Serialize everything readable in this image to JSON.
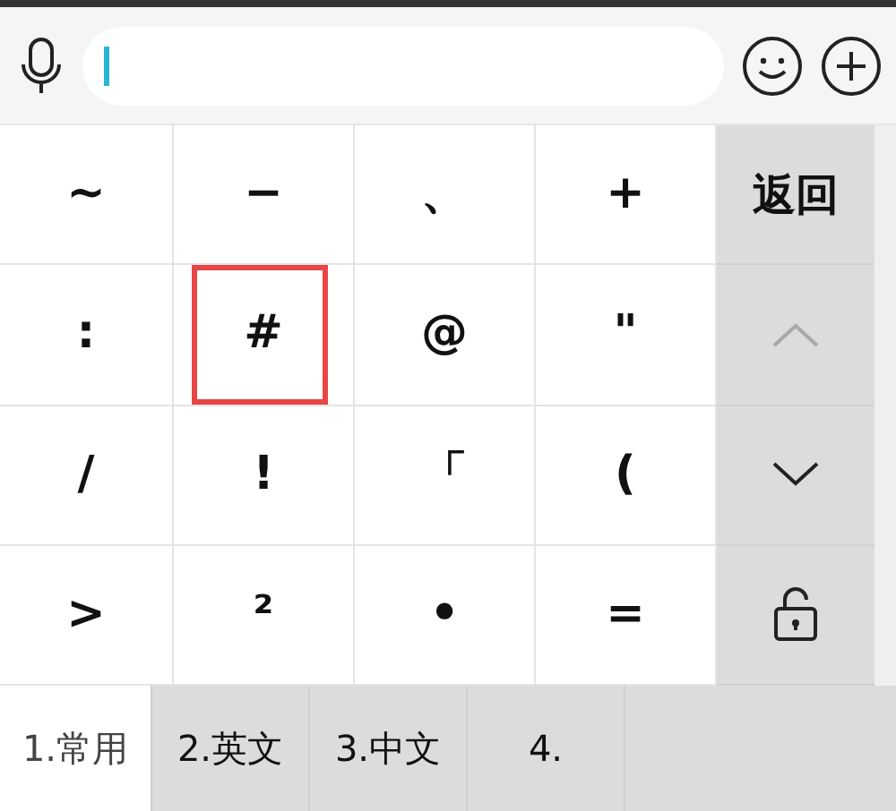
{
  "keys": [
    {
      "label": "~",
      "highlighted": false
    },
    {
      "label": "−",
      "highlighted": false
    },
    {
      "label": "、",
      "highlighted": false
    },
    {
      "label": "+",
      "highlighted": false
    },
    {
      "label": ":",
      "highlighted": false
    },
    {
      "label": "#",
      "highlighted": true
    },
    {
      "label": "@",
      "highlighted": false
    },
    {
      "label": "\"",
      "highlighted": false
    },
    {
      "label": "/",
      "highlighted": false
    },
    {
      "label": "!",
      "highlighted": false
    },
    {
      "label": "「",
      "highlighted": false
    },
    {
      "label": "(",
      "highlighted": false
    },
    {
      "label": ">",
      "highlighted": false
    },
    {
      "label": "²",
      "highlighted": false
    },
    {
      "label": "•",
      "highlighted": false
    },
    {
      "label": "=",
      "highlighted": false
    }
  ],
  "side_keys": [
    {
      "kind": "text",
      "label": "返回"
    },
    {
      "kind": "up",
      "disabled": true
    },
    {
      "kind": "down",
      "disabled": false
    },
    {
      "kind": "lock"
    }
  ],
  "tabs": [
    {
      "label": "1.常用",
      "selected": true
    },
    {
      "label": "2.英文",
      "selected": false
    },
    {
      "label": "3.中文",
      "selected": false
    },
    {
      "label": "4.",
      "selected": false
    }
  ]
}
